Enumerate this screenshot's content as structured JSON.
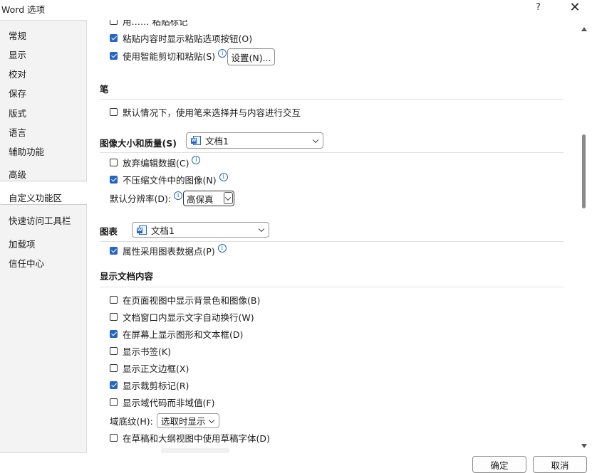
{
  "window": {
    "title": "Word 选项",
    "help": "?",
    "close": "✕"
  },
  "nav": {
    "items": [
      "常规",
      "显示",
      "校对",
      "保存",
      "版式",
      "语言",
      "辅助功能",
      "高级",
      "自定义功能区",
      "快速访问工具栏",
      "加载项",
      "信任中心"
    ]
  },
  "content": {
    "cut_top_label": "用…… 粘贴标记",
    "paste_options_label": "粘贴内容时显示粘贴选项按钮(O)",
    "smart_cut_label": "使用智能剪切和粘贴(S)",
    "settings_button": "设置(N)...",
    "pen_header": "笔",
    "pen_default_label": "默认情况下，使用笔来选择并与内容进行交互",
    "image_header": "图像大小和质量(S)",
    "image_doc": "文档1",
    "discard_edit_label": "放弃编辑数据(C)",
    "no_compress_label": "不压缩文件中的图像(N)",
    "default_res_label": "默认分辨率(D):",
    "default_res_value": "高保真",
    "chart_header": "图表",
    "chart_doc": "文档1",
    "chart_props_label": "属性采用图表数据点(P)",
    "display_header": "显示文档内容",
    "display_items": [
      {
        "label": "在页面视图中显示背景色和图像(B)",
        "checked": false
      },
      {
        "label": "文档窗口内显示文字自动换行(W)",
        "checked": false
      },
      {
        "label": "在屏幕上显示图形和文本框(D)",
        "checked": true
      },
      {
        "label": "显示书签(K)",
        "checked": false
      },
      {
        "label": "显示正文边框(X)",
        "checked": false
      },
      {
        "label": "显示裁剪标记(R)",
        "checked": true
      },
      {
        "label": "显示域代码而非域值(F)",
        "checked": false
      }
    ],
    "field_shading_label": "域底纹(H):",
    "field_shading_value": "选取时显示",
    "draft_font_label": "在草稿和大纲视图中使用草稿字体(D)"
  },
  "footer": {
    "ok": "确定",
    "cancel": "取消"
  },
  "colors": {
    "accent": "#2466c2",
    "nav_bg": "#f3f3f3"
  }
}
